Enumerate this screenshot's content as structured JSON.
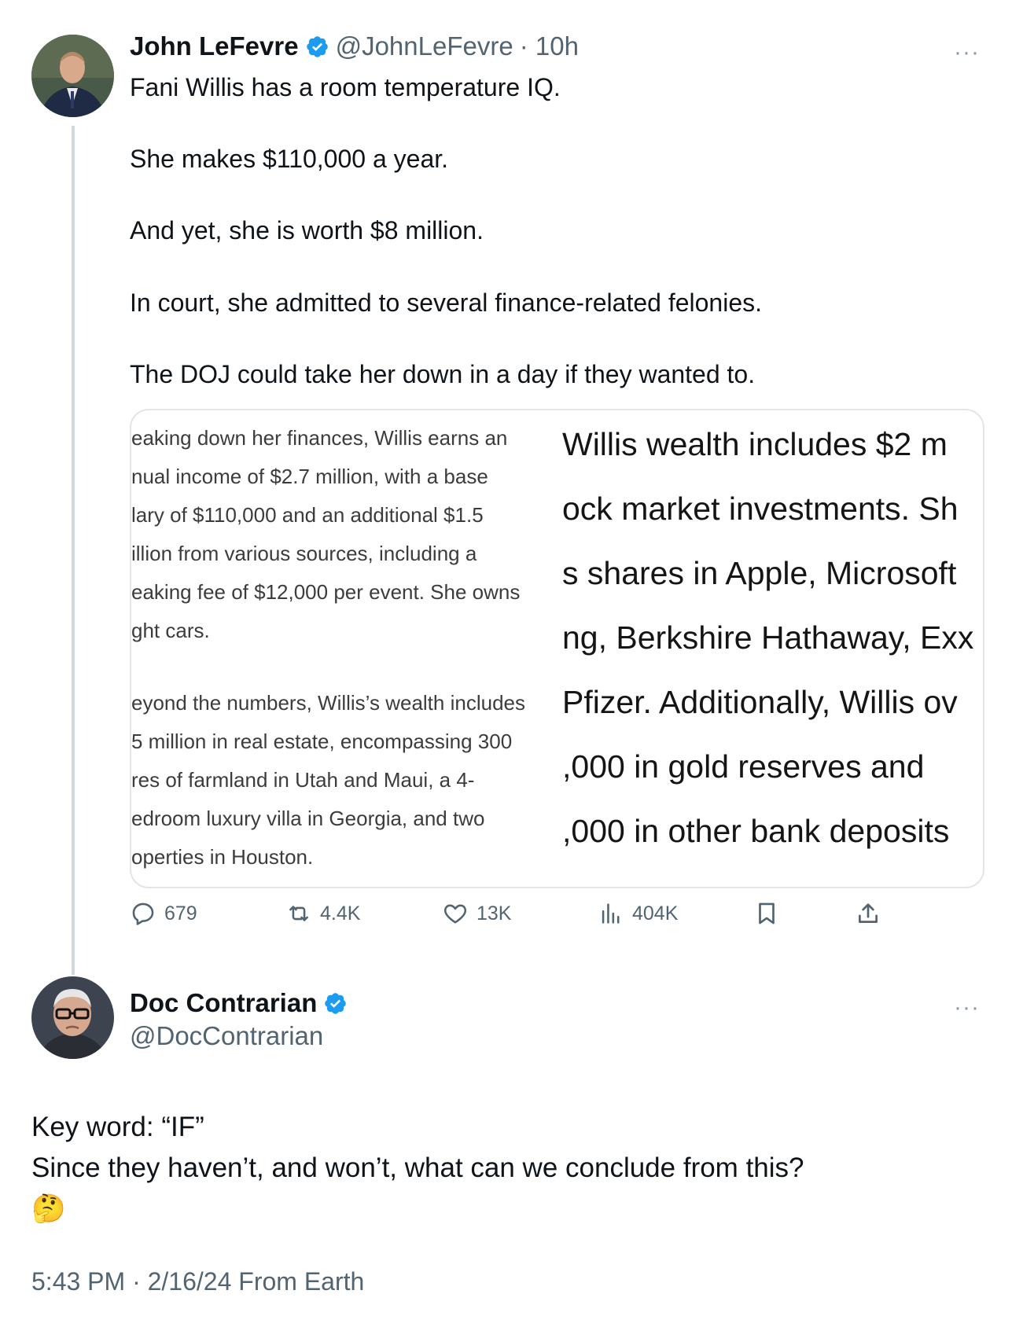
{
  "tweet": {
    "author_name": "John LeFevre",
    "handle": "@JohnLeFevre",
    "time": "· 10h",
    "more": "···",
    "lines": [
      "Fani Willis has a room temperature IQ.",
      "She makes $110,000 a year.",
      "And yet, she is worth $8 million.",
      "In court, she admitted to several finance-related felonies.",
      "The DOJ could take her down in a day if they wanted to."
    ],
    "media": {
      "left_lines": [
        "eaking down her finances, Willis earns an",
        "nual income of $2.7 million, with a base",
        "lary of $110,000 and an additional $1.5",
        "illion from various sources, including a",
        "eaking fee of $12,000 per event. She owns",
        "ght cars.",
        "eyond the numbers, Willis’s wealth includes",
        "5 million in real estate, encompassing 300",
        "res of farmland in Utah and Maui, a 4-",
        "edroom luxury villa in Georgia, and two",
        "operties in Houston."
      ],
      "right_lines": [
        "Willis wealth includes $2 m",
        "ock market investments. Sh",
        "s shares in Apple, Microsoft",
        "ng, Berkshire Hathaway, Exx",
        "Pfizer. Additionally, Willis ov",
        ",000 in gold reserves and",
        ",000 in other bank deposits"
      ]
    },
    "actions": {
      "replies": "679",
      "reposts": "4.4K",
      "likes": "13K",
      "views": "404K"
    }
  },
  "reply": {
    "author_name": "Doc Contrarian",
    "handle": "@DocContrarian",
    "more": "···",
    "line1": "Key word: “IF”",
    "line2": "Since they haven’t, and won’t, what can we conclude from this?",
    "emoji": "🤔",
    "footer": "5:43 PM · 2/16/24 From Earth"
  },
  "colors": {
    "verified": "#1d9bf0",
    "secondary_text": "#536471",
    "thread_line": "#cfd9de"
  }
}
